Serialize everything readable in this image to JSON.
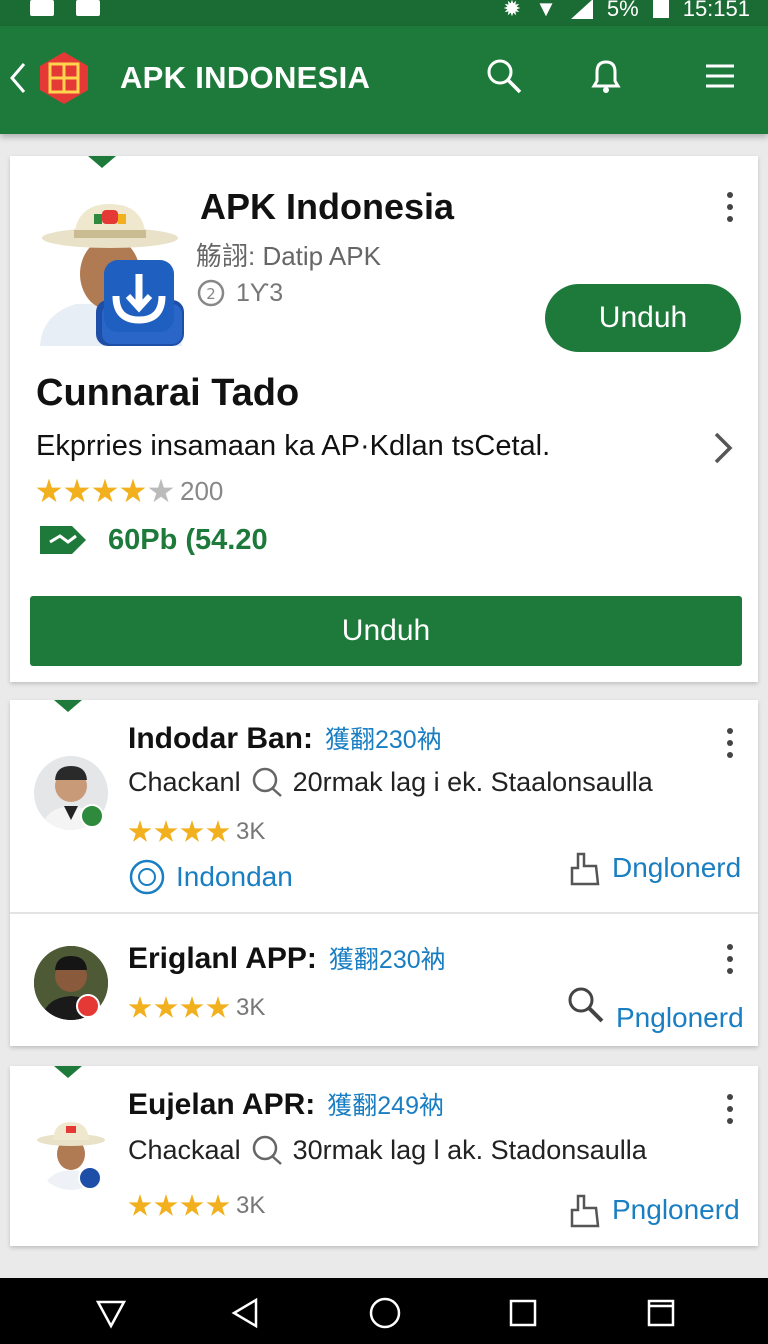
{
  "status_bar": {
    "battery": "5%",
    "time": "15:151"
  },
  "app_bar": {
    "title": "APK INDONESIA",
    "icons": [
      "back-icon",
      "logo-icon",
      "search-icon",
      "bell-icon",
      "menu-icon"
    ]
  },
  "featured": {
    "title": "APK Indonesia",
    "subtitle": "觞詡: Datip APK",
    "count": "1Ƴ3",
    "install_label": "Unduh",
    "heading": "Cunnarai Tado",
    "description": "Ekprries insamaan ka AP·Kdlan tsCetal.",
    "rating_count": "200",
    "price": "60Pb (54.20",
    "download_label": "Unduh"
  },
  "list": [
    {
      "title": "Indodar Ban:",
      "tag": "獲翻230衲",
      "subtitle": "Chackanl",
      "subtitle_detail": "20rmak lag i ek. Staalonsaulla",
      "rating_count": "3K",
      "left_action": "Indondan",
      "right_action": "Dnglonerd",
      "badge_color": "#2e8b3e"
    },
    {
      "title": "Eriglanl APP:",
      "tag": "獲翻230衲",
      "rating_count": "3K",
      "right_action": "Pnglonerd",
      "badge_color": "#e53935"
    },
    {
      "title": "Eujelan APR:",
      "tag": "獲翻249衲",
      "subtitle": "Chackaal",
      "subtitle_detail": "30rmak lag l ak. Stadonsaulla",
      "rating_count": "3K",
      "right_action": "Pnglonerd",
      "badge_color": "#1e4fa8"
    }
  ],
  "colors": {
    "primary": "#1e7a3b",
    "accent": "#1a7ec2",
    "star": "#f2b01e"
  }
}
